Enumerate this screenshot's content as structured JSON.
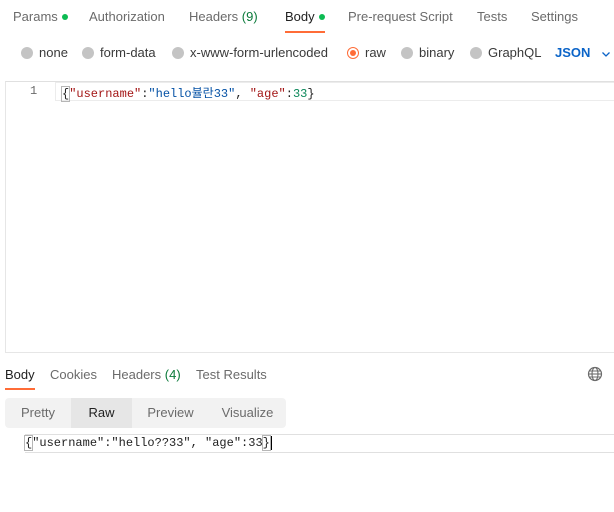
{
  "request_tabs": [
    {
      "label": "Params",
      "dot": true
    },
    {
      "label": "Authorization"
    },
    {
      "label": "Headers",
      "count": "(9)"
    },
    {
      "label": "Body",
      "dot": true,
      "active": true
    },
    {
      "label": "Pre-request Script"
    },
    {
      "label": "Tests"
    },
    {
      "label": "Settings"
    }
  ],
  "body_types": [
    {
      "label": "none"
    },
    {
      "label": "form-data"
    },
    {
      "label": "x-www-form-urlencoded"
    },
    {
      "label": "raw",
      "selected": true
    },
    {
      "label": "binary"
    },
    {
      "label": "GraphQL"
    }
  ],
  "format_select": {
    "value": "JSON",
    "icon": "chevron-down-icon"
  },
  "editor": {
    "line_number": "1",
    "open_brace": "{",
    "key1": "\"username\"",
    "colon1": ":",
    "val1": "\"hello뷸란33\"",
    "comma": ", ",
    "key2": "\"age\"",
    "colon2": ":",
    "val2": "33",
    "close_brace": "}"
  },
  "response_tabs": [
    {
      "label": "Body",
      "active": true
    },
    {
      "label": "Cookies"
    },
    {
      "label": "Headers",
      "count": "(4)"
    },
    {
      "label": "Test Results"
    }
  ],
  "view_modes": [
    {
      "label": "Pretty"
    },
    {
      "label": "Raw",
      "active": true
    },
    {
      "label": "Preview"
    },
    {
      "label": "Visualize"
    }
  ],
  "response_body": {
    "open_brace": "{",
    "text": "\"username\":\"hello??33\", \"age\":33",
    "close_brace": "}"
  },
  "colors": {
    "accent": "#ff6c37",
    "green": "#0cbb52",
    "link_blue": "#0b64c8"
  },
  "icons": {
    "globe": "globe-icon"
  }
}
